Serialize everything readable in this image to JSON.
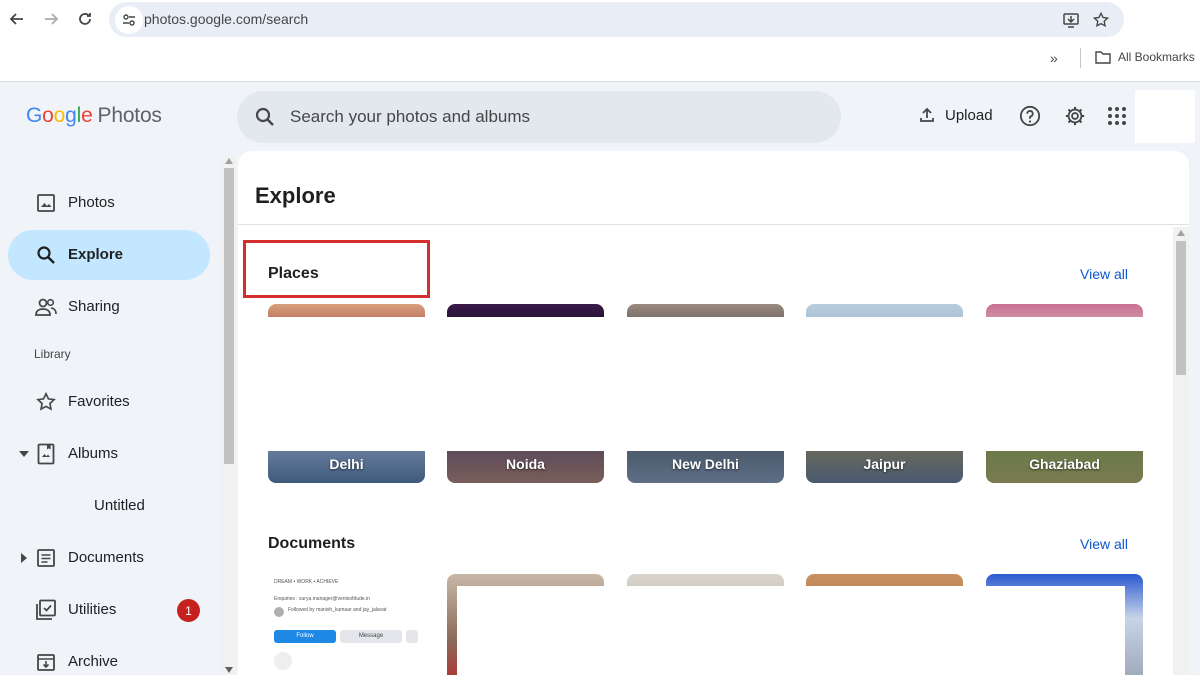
{
  "browser": {
    "url": "photos.google.com/search",
    "bookmarks_overflow": "»",
    "bookmarks_label": "All Bookmarks"
  },
  "header": {
    "logo": {
      "letters": [
        "G",
        "o",
        "o",
        "g",
        "l",
        "e"
      ],
      "suffix": "Photos"
    },
    "search_placeholder": "Search your photos and albums",
    "upload_label": "Upload"
  },
  "sidebar": {
    "items": [
      {
        "label": "Photos",
        "icon": "photo-icon",
        "active": false
      },
      {
        "label": "Explore",
        "icon": "search-icon",
        "active": true
      },
      {
        "label": "Sharing",
        "icon": "people-icon",
        "active": false
      }
    ],
    "library_heading": "Library",
    "library_items": [
      {
        "label": "Favorites",
        "icon": "star-icon"
      },
      {
        "label": "Albums",
        "icon": "album-icon",
        "expanded": true
      },
      {
        "label": "Untitled",
        "icon": ""
      },
      {
        "label": "Documents",
        "icon": "document-icon",
        "expanded": false
      },
      {
        "label": "Utilities",
        "icon": "utilities-icon",
        "badge": "1"
      },
      {
        "label": "Archive",
        "icon": "archive-icon"
      }
    ]
  },
  "main": {
    "title": "Explore",
    "sections": [
      {
        "title": "Places",
        "view_all": "View all",
        "cards": [
          "Delhi",
          "Noida",
          "New Delhi",
          "Jaipur",
          "Ghaziabad"
        ]
      },
      {
        "title": "Documents",
        "view_all": "View all",
        "cards": [
          "",
          "",
          "",
          "",
          ""
        ]
      }
    ],
    "document_preview": {
      "line1": "DREAM • WORK • ACHIEVE",
      "line2": "Enquiries : surya.manager@ventsofdude.in",
      "followed_by": "Followed by manish_kumaar and jay_jalavat",
      "follow_button": "Follow",
      "message_button": "Message"
    }
  },
  "colors": {
    "accent_active": "#c2e7ff",
    "link": "#0b57d0",
    "badge": "#c5221f",
    "highlight_box": "#d32f2f"
  }
}
